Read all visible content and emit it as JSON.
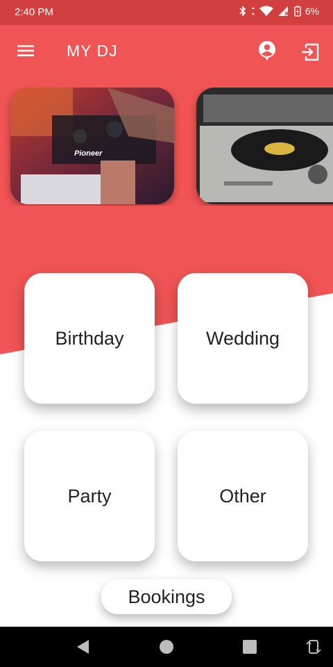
{
  "status_bar": {
    "time": "2:40 PM",
    "battery": "6%"
  },
  "app_bar": {
    "title": "MY DJ",
    "icons": [
      "menu-icon",
      "account-circle-icon",
      "logout-icon"
    ]
  },
  "carousel": {
    "items": [
      {
        "label": "DJ mixer photo",
        "brand_text": "Pioneer"
      },
      {
        "label": "Turntable photo"
      }
    ]
  },
  "categories": [
    {
      "label": "Birthday"
    },
    {
      "label": "Wedding"
    },
    {
      "label": "Party"
    },
    {
      "label": "Other"
    }
  ],
  "bookings": {
    "label": "Bookings"
  },
  "colors": {
    "primary": "#f05454",
    "status_bar": "#d23f3f",
    "tile": "#ffffff",
    "nav_bar": "#000000"
  },
  "nav": {
    "icons": [
      "back-icon",
      "home-icon",
      "recents-icon",
      "rotate-icon"
    ]
  }
}
